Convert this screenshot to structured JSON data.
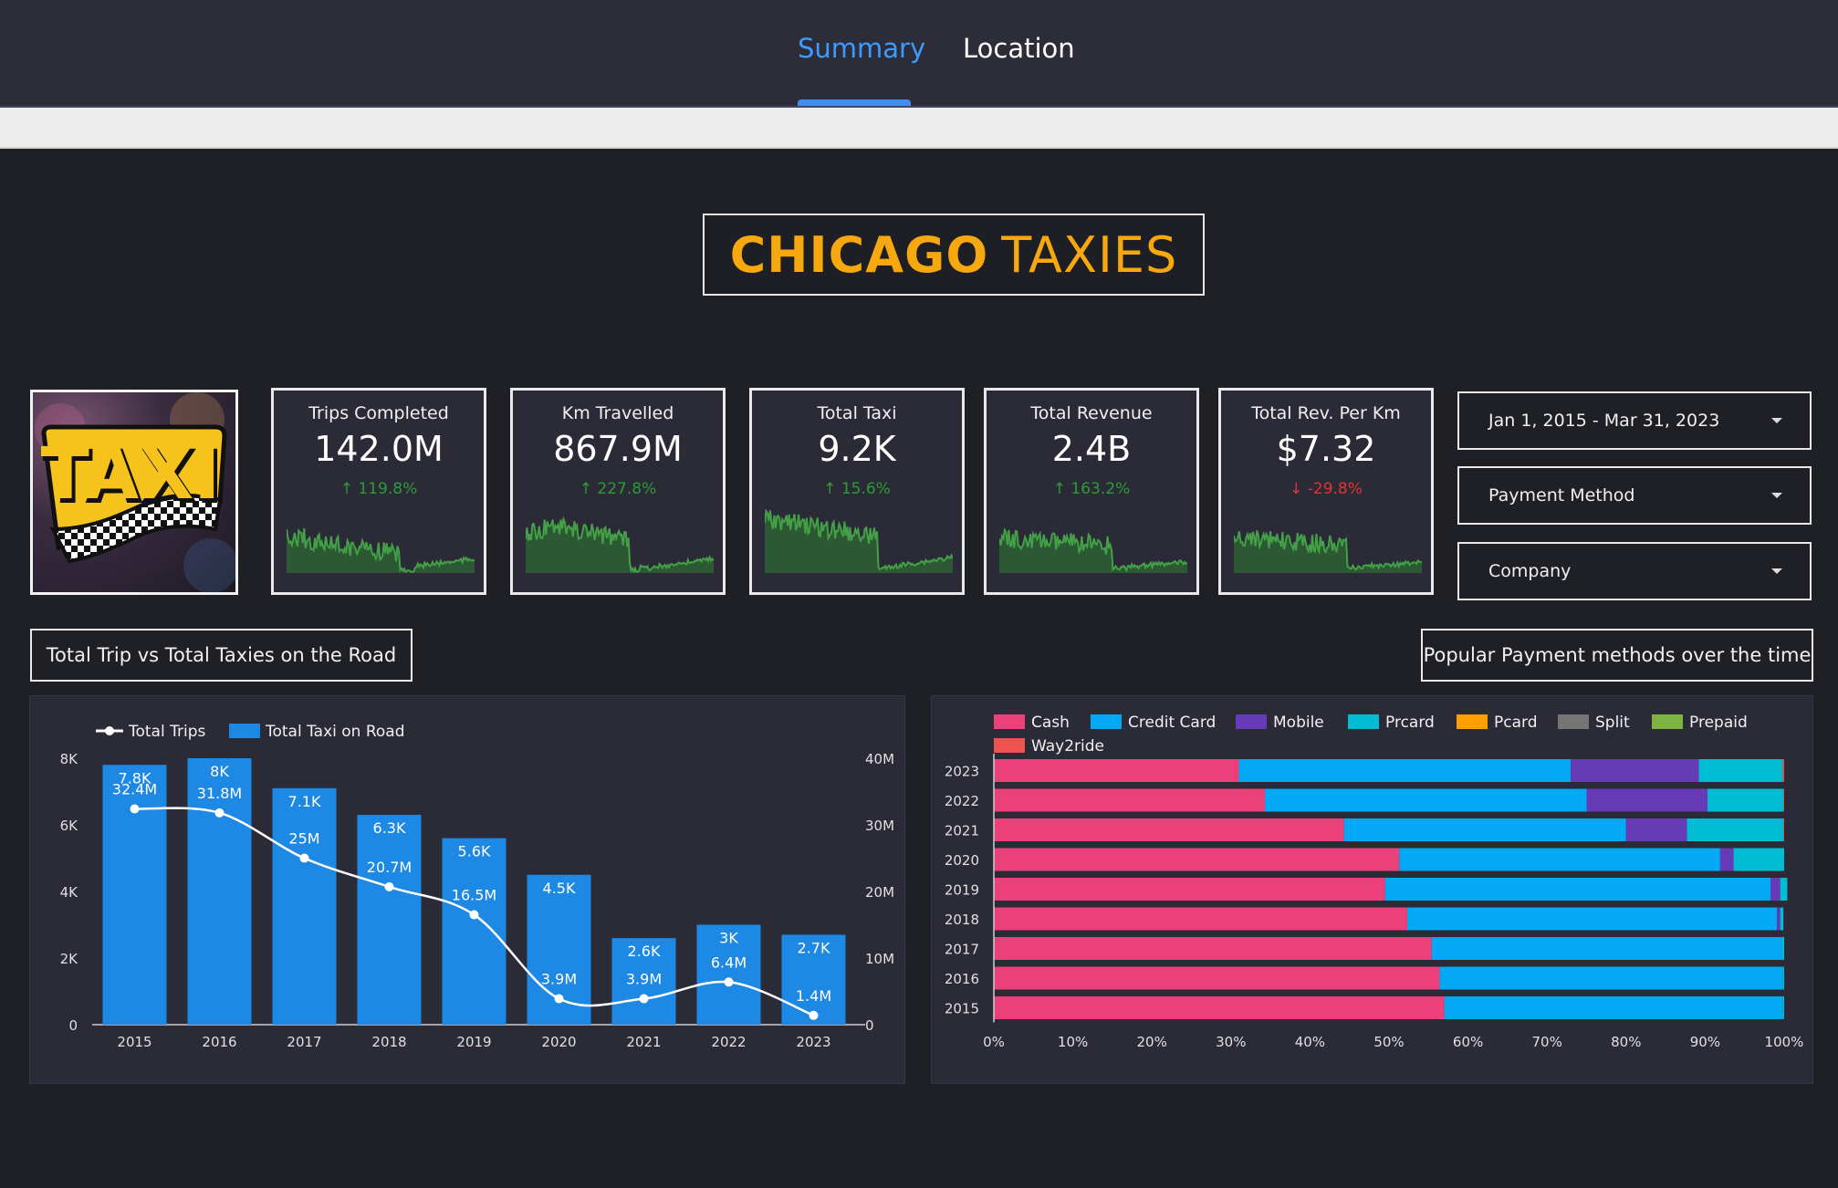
{
  "tabs": [
    {
      "label": "Summary",
      "active": true
    },
    {
      "label": "Location",
      "active": false
    }
  ],
  "title": {
    "part1": "CHICAGO",
    "part2": "TAXIES"
  },
  "logo": {
    "text": "TAXI"
  },
  "kpis": [
    {
      "label": "Trips Completed",
      "value": "142.0M",
      "change": "119.8%",
      "direction": "up"
    },
    {
      "label": "Km Travelled",
      "value": "867.9M",
      "change": "227.8%",
      "direction": "up"
    },
    {
      "label": "Total Taxi",
      "value": "9.2K",
      "change": "15.6%",
      "direction": "up"
    },
    {
      "label": "Total Revenue",
      "value": "2.4B",
      "change": "163.2%",
      "direction": "up"
    },
    {
      "label": "Total Rev. Per Km",
      "value": "$7.32",
      "change": "-29.8%",
      "direction": "down"
    }
  ],
  "filters": {
    "date_range": "Jan 1, 2015 - Mar 31, 2023",
    "payment": "Payment Method",
    "company": "Company"
  },
  "sections": {
    "left_title": "Total Trip vs Total Taxies on the Road",
    "right_title": "Popular Payment methods over the time"
  },
  "colors": {
    "accent": "#3d9bff",
    "title": "#f7a80f",
    "positive": "#2f9a3a",
    "negative": "#e03434",
    "bar": "#1e88e5"
  },
  "chart_data": [
    {
      "type": "bar",
      "categories": [
        "2015",
        "2016",
        "2017",
        "2018",
        "2019",
        "2020",
        "2021",
        "2022",
        "2023"
      ],
      "series": [
        {
          "name": "Total Taxi on Road",
          "type": "bar",
          "axis": "left",
          "values": [
            7800,
            8000,
            7100,
            6300,
            5600,
            4500,
            2600,
            3000,
            2700
          ],
          "labels": [
            "7.8K",
            "8K",
            "7.1K",
            "6.3K",
            "5.6K",
            "4.5K",
            "2.6K",
            "3K",
            "2.7K"
          ]
        },
        {
          "name": "Total Trips",
          "type": "line",
          "axis": "right",
          "values": [
            32.4,
            31.8,
            25,
            20.7,
            16.5,
            3.9,
            3.9,
            6.4,
            1.4
          ],
          "labels": [
            "32.4M",
            "31.8M",
            "25M",
            "20.7M",
            "16.5M",
            "3.9M",
            "3.9M",
            "6.4M",
            "1.4M"
          ]
        }
      ],
      "y_left": {
        "range": [
          0,
          8000
        ],
        "ticks": [
          "0",
          "2K",
          "4K",
          "6K",
          "8K"
        ]
      },
      "y_right": {
        "range": [
          0,
          40
        ],
        "ticks": [
          "0",
          "10M",
          "20M",
          "30M",
          "40M"
        ]
      },
      "legend": [
        "Total Trips",
        "Total Taxi on Road"
      ],
      "legend_position": "top-left"
    },
    {
      "type": "bar",
      "orientation": "horizontal-stacked-100",
      "categories": [
        "2023",
        "2022",
        "2021",
        "2020",
        "2019",
        "2018",
        "2017",
        "2016",
        "2015"
      ],
      "legend": [
        "Cash",
        "Credit Card",
        "Mobile",
        "Prcard",
        "Pcard",
        "Split",
        "Prepaid",
        "Way2ride"
      ],
      "legend_colors": [
        "#ec407a",
        "#03a9f4",
        "#673ab7",
        "#00bcd4",
        "#ffa000",
        "#757575",
        "#7cb342",
        "#ef5350"
      ],
      "series": [
        {
          "name": "Cash",
          "values": [
            31,
            34.3,
            44.3,
            51.3,
            49.5,
            52.3,
            55.4,
            56.4,
            57
          ]
        },
        {
          "name": "Credit Card",
          "values": [
            42,
            40.7,
            35.7,
            40.6,
            48.8,
            46.8,
            44.3,
            43.4,
            42.8
          ]
        },
        {
          "name": "Mobile",
          "values": [
            16.2,
            15.3,
            7.7,
            1.7,
            1.2,
            0.4,
            0,
            0,
            0
          ]
        },
        {
          "name": "Prcard",
          "values": [
            10.6,
            9.6,
            12.2,
            6.4,
            0.9,
            0.4,
            0.3,
            0.2,
            0.2
          ]
        },
        {
          "name": "Pcard",
          "values": [
            0,
            0,
            0,
            0,
            0,
            0,
            0,
            0,
            0
          ]
        },
        {
          "name": "Split",
          "values": [
            0,
            0,
            0,
            0,
            0,
            0,
            0,
            0,
            0
          ]
        },
        {
          "name": "Prepaid",
          "values": [
            0,
            0,
            0,
            0,
            0,
            0,
            0,
            0,
            0
          ]
        },
        {
          "name": "Way2ride",
          "values": [
            0.2,
            0.1,
            0.1,
            0,
            0,
            0,
            0,
            0,
            0
          ]
        }
      ],
      "x_ticks": [
        "0%",
        "10%",
        "20%",
        "30%",
        "40%",
        "50%",
        "60%",
        "70%",
        "80%",
        "90%",
        "100%"
      ],
      "xlim": [
        0,
        100
      ],
      "legend_position": "top"
    }
  ]
}
